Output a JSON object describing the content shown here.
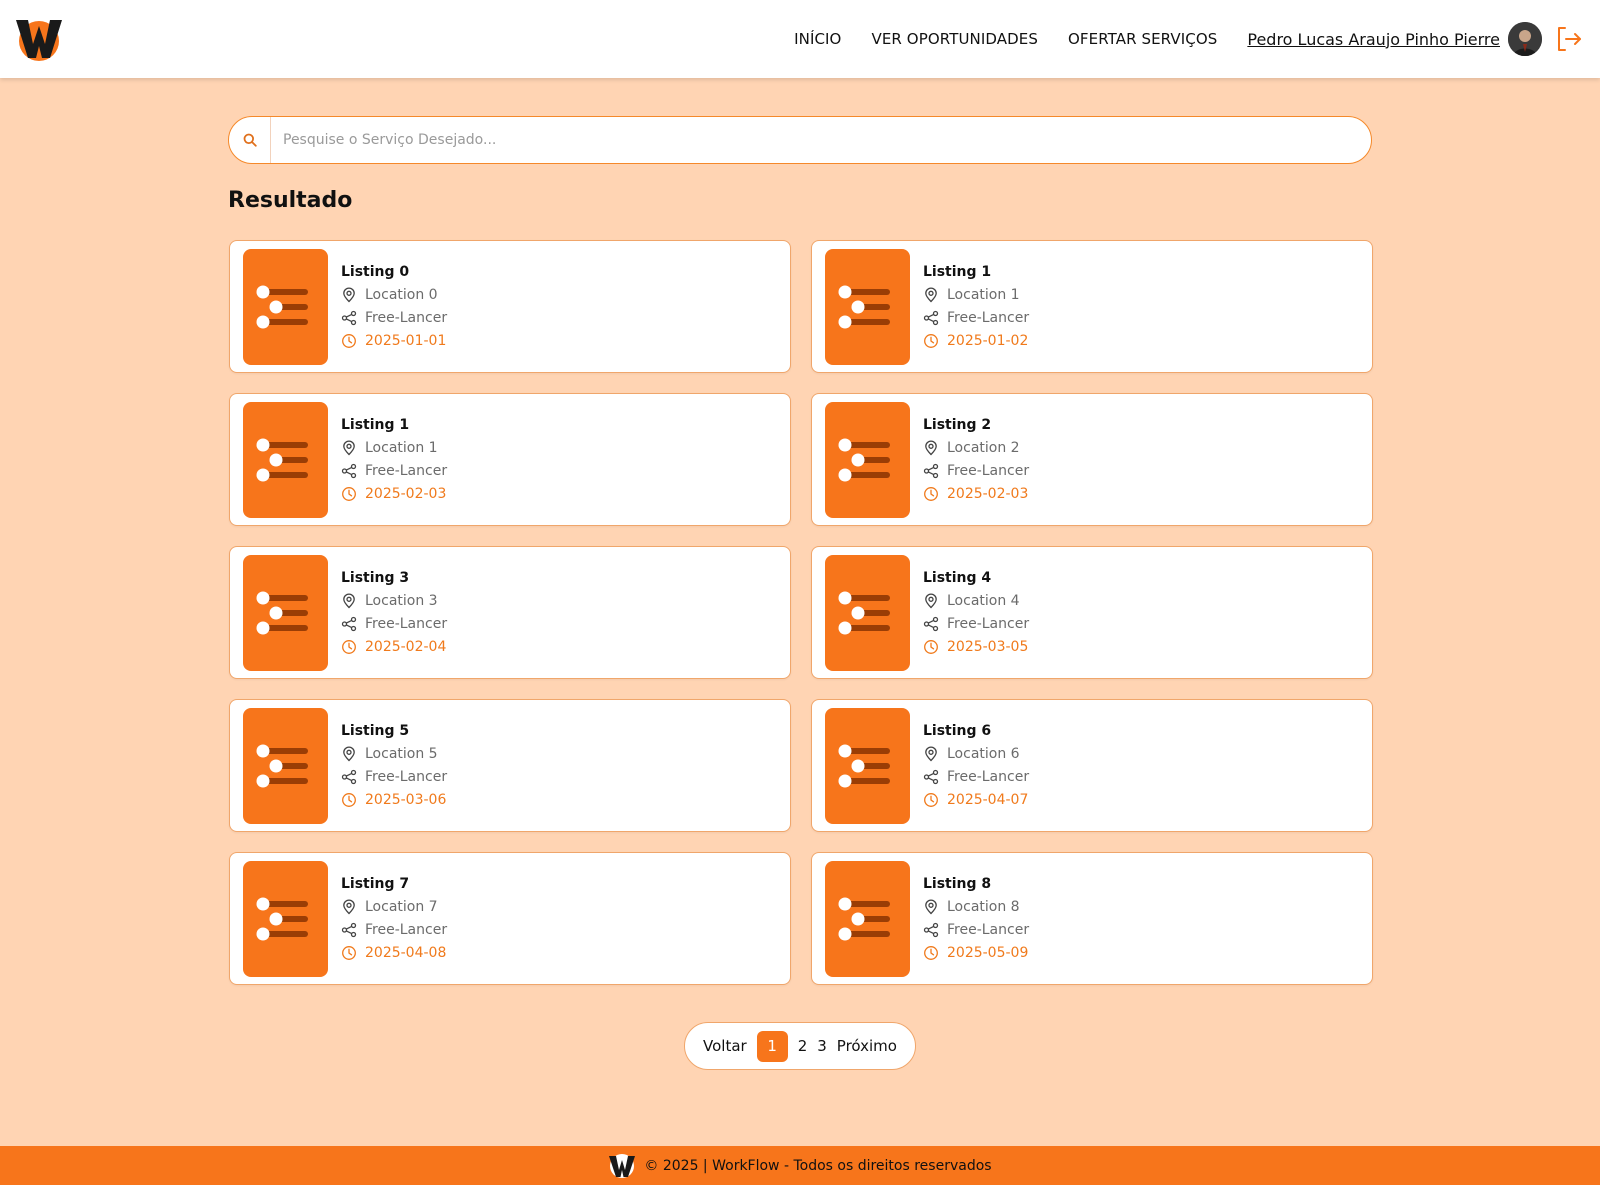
{
  "colors": {
    "accent": "#f7751b",
    "background": "#ffd4b3",
    "card_border": "#f0a66b",
    "date_text": "#f07a1c"
  },
  "header": {
    "logo_icon": "workflow-w-logo",
    "nav": [
      {
        "label": "INÍCIO"
      },
      {
        "label": "VER OPORTUNIDADES"
      },
      {
        "label": "OFERTAR SERVIÇOS"
      }
    ],
    "user_name": "Pedro Lucas Araujo Pinho Pierre",
    "logout_icon": "logout-icon"
  },
  "search": {
    "placeholder": "Pesquise o Serviço Desejado...",
    "value": ""
  },
  "results": {
    "title": "Resultado",
    "items": [
      {
        "title": "Listing 0",
        "location": "Location 0",
        "type": "Free-Lancer",
        "date": "2025-01-01"
      },
      {
        "title": "Listing 1",
        "location": "Location 1",
        "type": "Free-Lancer",
        "date": "2025-01-02"
      },
      {
        "title": "Listing 1",
        "location": "Location 1",
        "type": "Free-Lancer",
        "date": "2025-02-03"
      },
      {
        "title": "Listing 2",
        "location": "Location 2",
        "type": "Free-Lancer",
        "date": "2025-02-03"
      },
      {
        "title": "Listing 3",
        "location": "Location 3",
        "type": "Free-Lancer",
        "date": "2025-02-04"
      },
      {
        "title": "Listing 4",
        "location": "Location 4",
        "type": "Free-Lancer",
        "date": "2025-03-05"
      },
      {
        "title": "Listing 5",
        "location": "Location 5",
        "type": "Free-Lancer",
        "date": "2025-03-06"
      },
      {
        "title": "Listing 6",
        "location": "Location 6",
        "type": "Free-Lancer",
        "date": "2025-04-07"
      },
      {
        "title": "Listing 7",
        "location": "Location 7",
        "type": "Free-Lancer",
        "date": "2025-04-08"
      },
      {
        "title": "Listing 8",
        "location": "Location 8",
        "type": "Free-Lancer",
        "date": "2025-05-09"
      }
    ]
  },
  "pagination": {
    "prev_label": "Voltar",
    "next_label": "Próximo",
    "pages": [
      "1",
      "2",
      "3"
    ],
    "current": "1"
  },
  "footer": {
    "text": "© 2025 | WorkFlow - Todos os direitos reservados"
  }
}
